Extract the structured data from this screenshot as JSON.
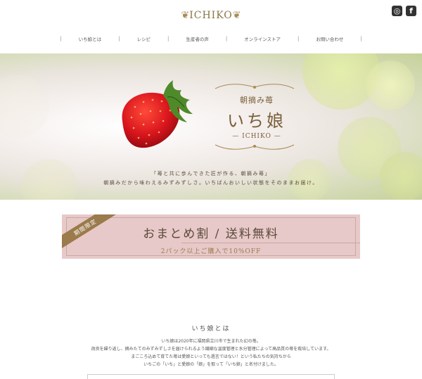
{
  "header": {
    "logo_text": "ICHIKO",
    "social": {
      "instagram_label": "◎",
      "facebook_label": "f"
    },
    "nav": [
      "いち娘とは",
      "レシピ",
      "生産者の声",
      "オンラインストア",
      "お問い合わせ"
    ]
  },
  "hero": {
    "subtitle": "朝摘み苺",
    "title": "いち娘",
    "brand": "— ICHIKO —",
    "desc_line1": "「苺と共に歩んできた匠が作る、朝摘み苺」",
    "desc_line2": "朝摘みだから味わえるみずみずしさ。いちばんおいしい状態をそのままお届け。"
  },
  "banner": {
    "ribbon": "期間限定",
    "title": "おまとめ割 / 送料無料",
    "subtitle": "2パック以上ご購入で10%OFF"
  },
  "about": {
    "title": "いち娘とは",
    "lines": [
      "いち娘は2020年に福岡県立川市で生まれた幻の苺。",
      "改良を繰り返し、摘みたてのみずみずしさを届けられるよう繊細な温度管理と水分管理によって高品質の苺を栽培しています。",
      "まごころ込めて育てた苺は愛娘といっても過言ではない！という私たちの気持ちから",
      "いちごの「いち」と愛娘の「娘」を取って「いち娘」と名付けました。"
    ]
  },
  "colors": {
    "gold": "#8a7348",
    "banner_bg": "#e8c9c9",
    "ribbon": "#9b7a4b"
  }
}
